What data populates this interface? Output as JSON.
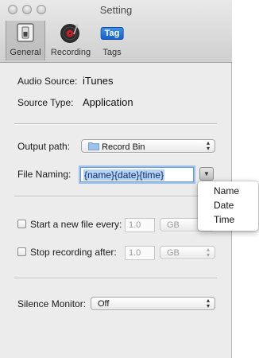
{
  "window": {
    "title": "Setting"
  },
  "toolbar": {
    "items": [
      {
        "label": "General",
        "icon": "switch-icon",
        "selected": true
      },
      {
        "label": "Recording",
        "icon": "record-disc-icon",
        "selected": false
      },
      {
        "label": "Tags",
        "icon": "tag-icon",
        "badge_text": "Tag",
        "selected": false
      }
    ]
  },
  "info": {
    "audio_source_label": "Audio Source:",
    "audio_source_value": "iTunes",
    "source_type_label": "Source Type:",
    "source_type_value": "Application"
  },
  "output": {
    "label": "Output path:",
    "value": "Record Bin",
    "icon": "folder-icon"
  },
  "naming": {
    "label": "File Naming:",
    "value": "{name}{date}{time}",
    "menu_items": [
      "Name",
      "Date",
      "Time"
    ]
  },
  "split": {
    "new_file_label": "Start a new file every:",
    "new_file_value": "1.0",
    "new_file_unit": "GB",
    "stop_label": "Stop recording after:",
    "stop_value": "1.0",
    "stop_unit": "GB"
  },
  "silence": {
    "label": "Silence Monitor:",
    "value": "Off"
  },
  "colors": {
    "accent": "#1f6fd6",
    "selection": "#b7d3f2"
  }
}
